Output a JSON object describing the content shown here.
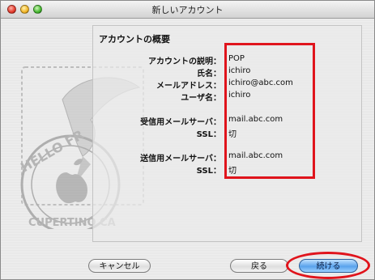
{
  "window": {
    "title": "新しいアカウント"
  },
  "summary": {
    "heading": "アカウントの概要",
    "rows": [
      {
        "label": "アカウントの説明：",
        "value": "POP"
      },
      {
        "label": "氏名：",
        "value": "ichiro"
      },
      {
        "label": "メールアドレス：",
        "value": "ichiro@abc.com"
      },
      {
        "label": "ユーザ名：",
        "value": "ichiro"
      },
      {
        "label": "受信用メールサーバ：",
        "value": "mail.abc.com"
      },
      {
        "label": "SSL：",
        "value": "切"
      },
      {
        "label": "送信用メールサーバ：",
        "value": "mail.abc.com"
      },
      {
        "label": "SSL：",
        "value": "切"
      }
    ]
  },
  "stamp": {
    "text_top": "HELLO FR",
    "text_bottom": "CUPERTINO CA"
  },
  "buttons": {
    "cancel": "キャンセル",
    "back": "戻る",
    "continue": "続ける"
  },
  "colors": {
    "highlight": "#e0141c",
    "default_button": "#5aa3ec"
  }
}
